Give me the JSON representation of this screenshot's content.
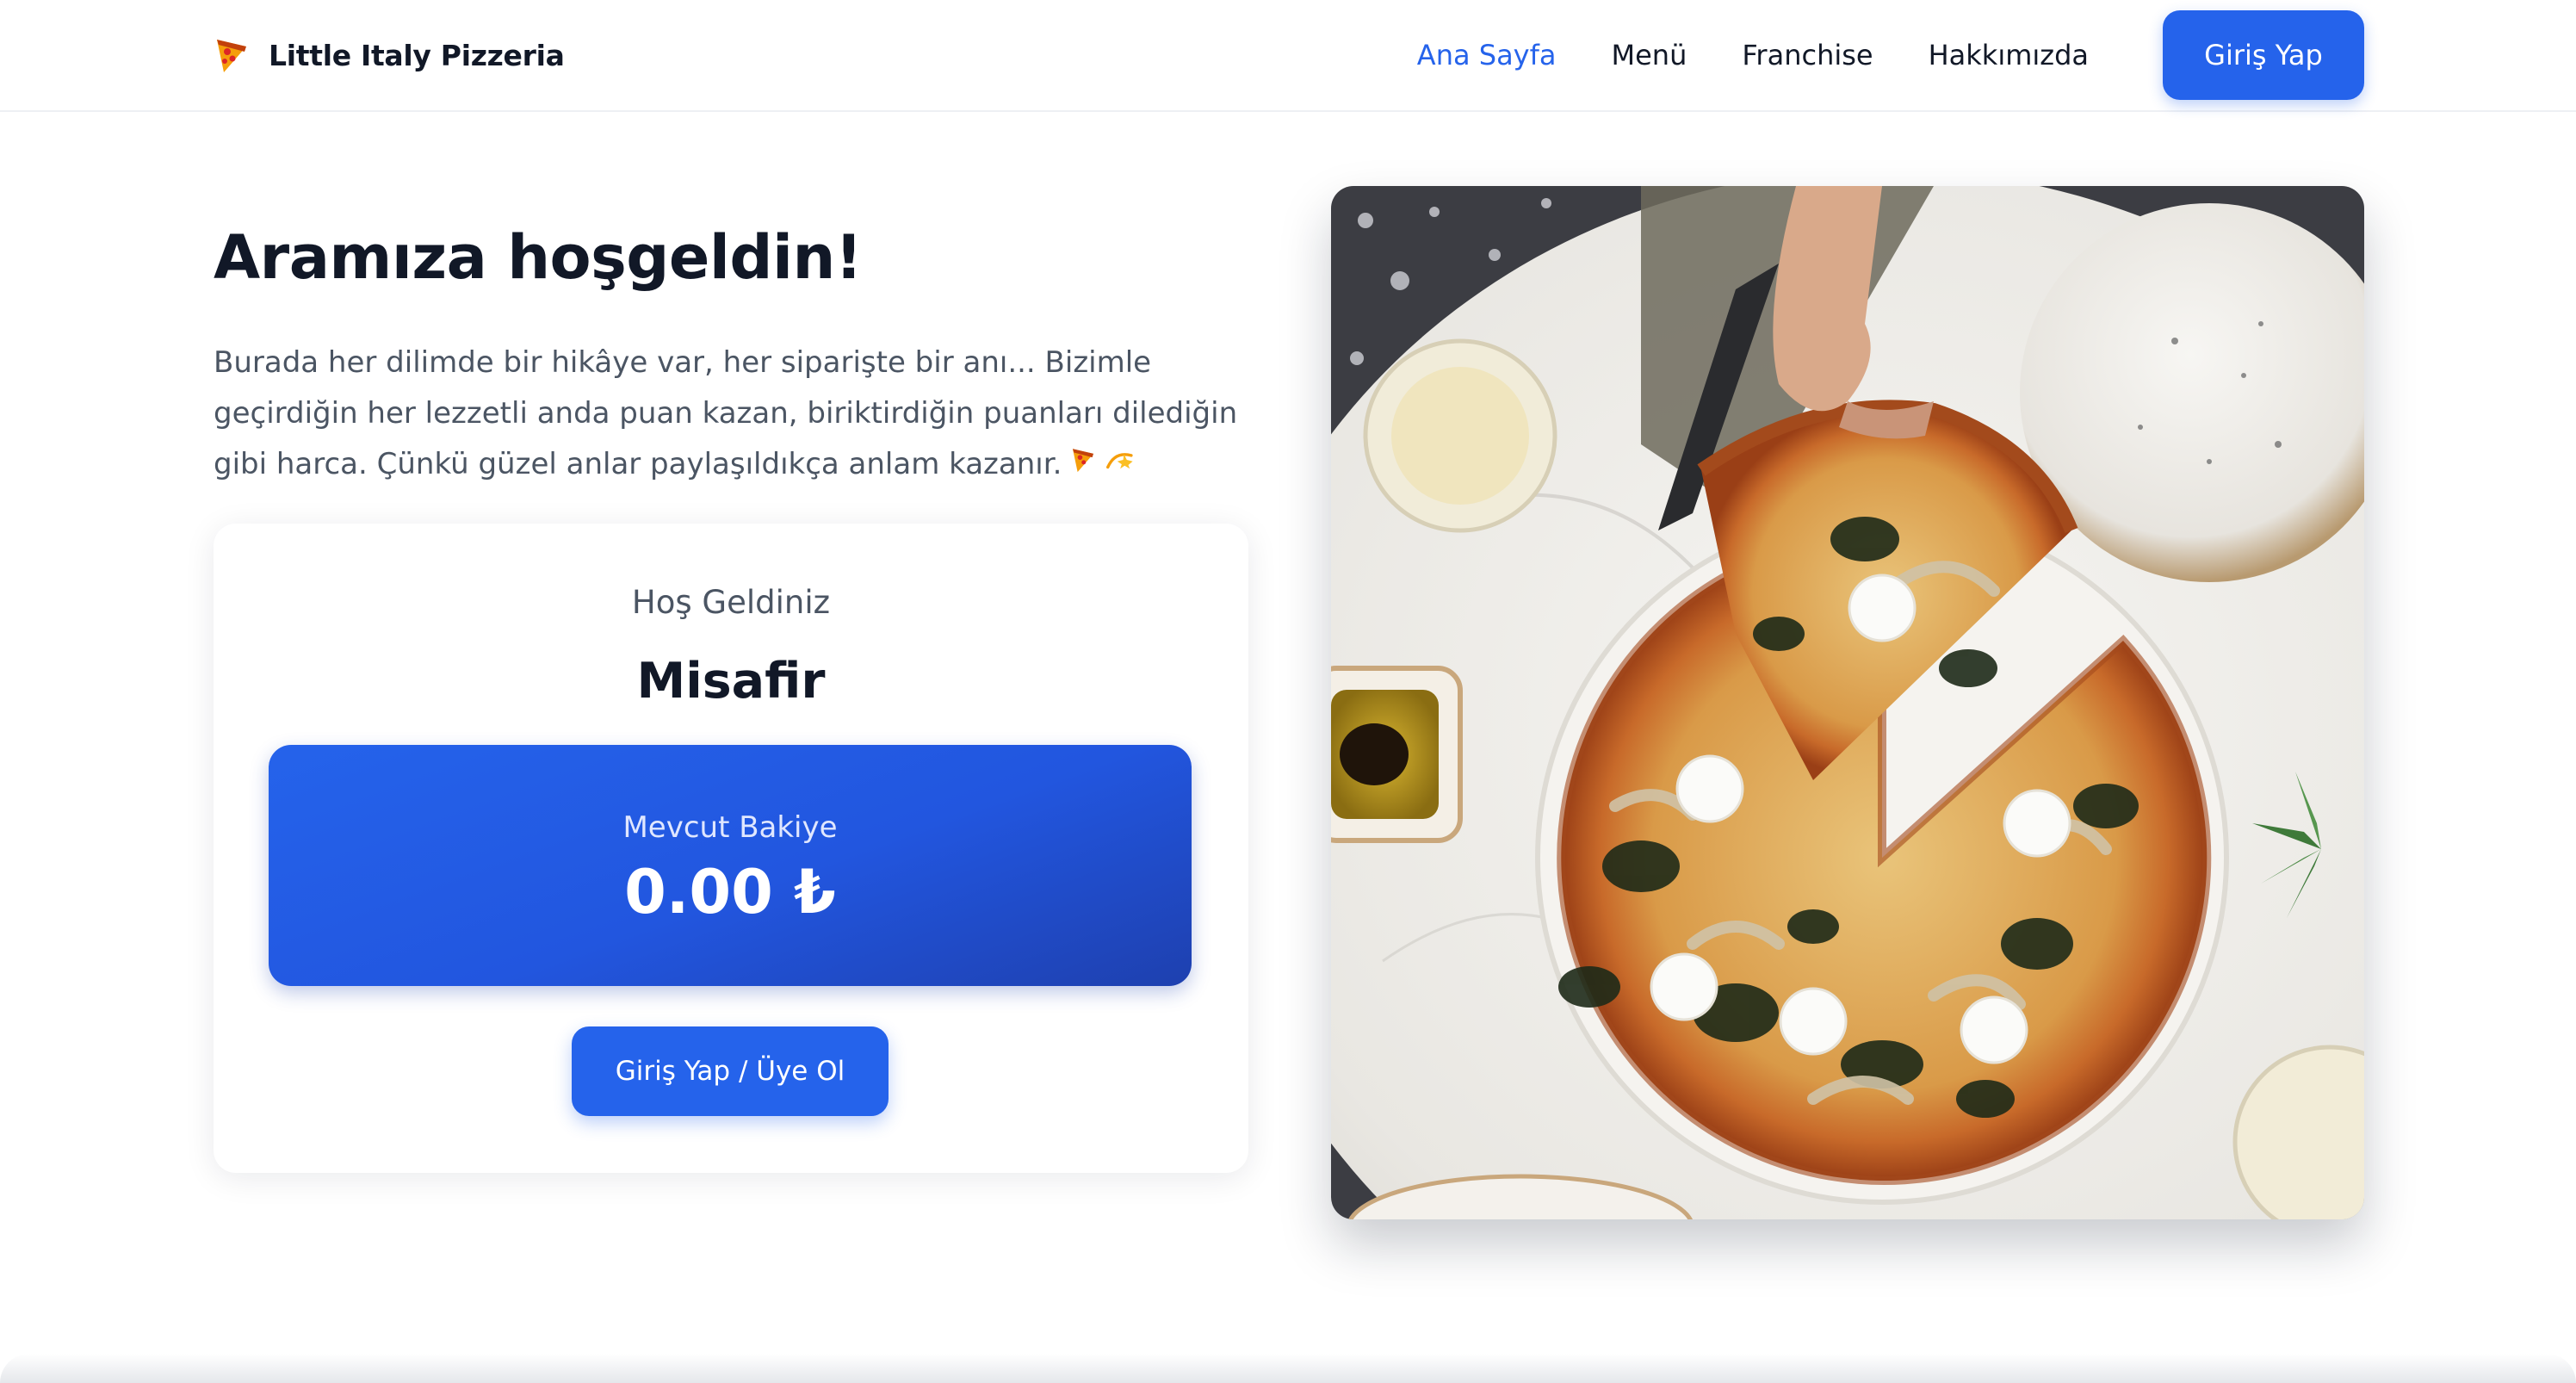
{
  "brand": {
    "name": "Little Italy Pizzeria",
    "icon": "pizza-slice-icon"
  },
  "nav": {
    "links": [
      {
        "label": "Ana Sayfa",
        "active": true
      },
      {
        "label": "Menü",
        "active": false
      },
      {
        "label": "Franchise",
        "active": false
      },
      {
        "label": "Hakkımızda",
        "active": false
      }
    ],
    "login_label": "Giriş Yap"
  },
  "hero": {
    "title": "Aramıza hoşgeldin!",
    "description": "Burada her dilimde bir hikâye var, her siparişte bir anı... Bizimle geçirdiğin her lezzetli anda puan kazan, biriktirdiğin puanları dilediğin gibi harca. Çünkü güzel anlar paylaşıldıkça anlam kazanır.",
    "description_icons": [
      "pizza-slice-icon",
      "dizzy-star-icon"
    ]
  },
  "welcome_card": {
    "greeting": "Hoş Geldiniz",
    "user_name": "Misafir",
    "balance_label": "Mevcut Bakiye",
    "balance_value": "0.00 ₺",
    "cta_label": "Giriş Yap / Üye Ol"
  },
  "image": {
    "subject": "pizza-photo"
  },
  "colors": {
    "accent": "#2563eb",
    "accent_dark": "#1e40af",
    "text_primary": "#111827",
    "text_muted": "#4b5563",
    "background": "#ffffff"
  }
}
